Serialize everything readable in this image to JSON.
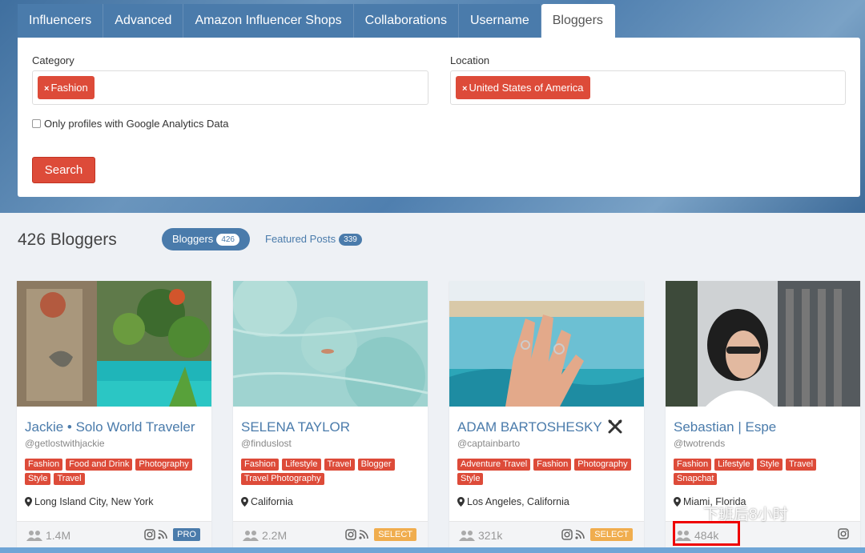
{
  "tabs": [
    {
      "label": "Influencers"
    },
    {
      "label": "Advanced"
    },
    {
      "label": "Amazon Influencer Shops"
    },
    {
      "label": "Collaborations"
    },
    {
      "label": "Username"
    },
    {
      "label": "Bloggers",
      "active": true
    }
  ],
  "filters": {
    "category_label": "Category",
    "category_chip": "Fashion",
    "location_label": "Location",
    "location_chip": "United States of America",
    "analytics_checkbox": "Only profiles with Google Analytics Data",
    "search_button": "Search",
    "chip_remove": "×"
  },
  "results": {
    "title": "426 Bloggers",
    "pill_bloggers": "Bloggers",
    "pill_bloggers_count": "426",
    "pill_posts": "Featured Posts",
    "pill_posts_count": "339"
  },
  "cards": [
    {
      "name": "Jackie • Solo World Traveler",
      "handle": "@getlostwithjackie",
      "tags": [
        "Fashion",
        "Food and Drink",
        "Photography",
        "Style",
        "Travel"
      ],
      "location": "Long Island City, New York",
      "followers": "1.4M",
      "plan": "PRO"
    },
    {
      "name": "SELENA TAYLOR",
      "handle": "@finduslost",
      "tags": [
        "Fashion",
        "Lifestyle",
        "Travel",
        "Blogger",
        "Travel Photography"
      ],
      "location": "California",
      "followers": "2.2M",
      "plan": "SELECT"
    },
    {
      "name": "ADAM BARTOSHESKY",
      "handle": "@captainbarto",
      "tags": [
        "Adventure Travel",
        "Fashion",
        "Photography",
        "Style"
      ],
      "location": "Los Angeles, California",
      "followers": "321k",
      "plan": "SELECT"
    },
    {
      "name": "Sebastian | Espe",
      "handle": "@twotrends",
      "tags": [
        "Fashion",
        "Lifestyle",
        "Style",
        "Travel",
        "Snapchat"
      ],
      "location": "Miami, Florida",
      "followers": "484k",
      "plan": ""
    }
  ],
  "watermark": "下班后8小时",
  "colors": {
    "accent": "#4a7bab",
    "tag": "#dd4b39",
    "select": "#f0ad4e"
  }
}
